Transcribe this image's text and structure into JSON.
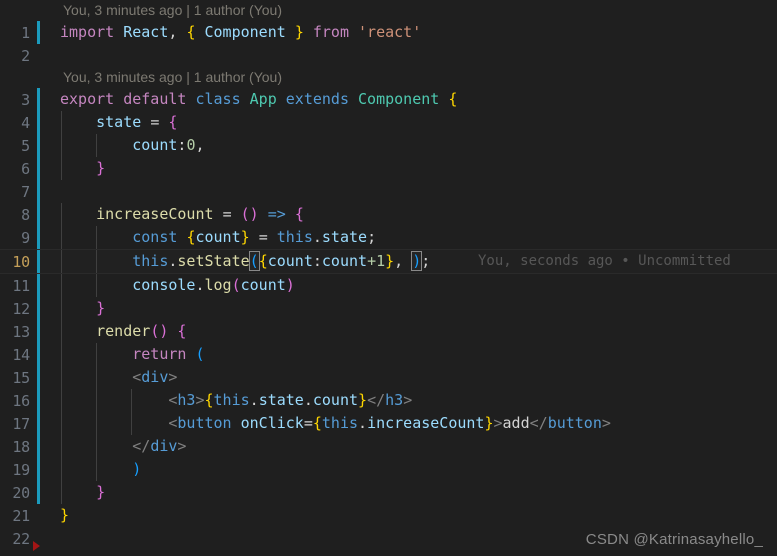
{
  "editor": {
    "language": "javascript-react",
    "theme": "dark-plus",
    "background_color": "#1f1f1f",
    "active_line": 10,
    "change_bar_color": "#1b9bbd",
    "active_line_number_color": "#c5a059"
  },
  "blame_annotations": [
    {
      "above_line": 1,
      "text": "You, 3 minutes ago | 1 author (You)"
    },
    {
      "above_line": 3,
      "text": "You, 3 minutes ago | 1 author (You)"
    }
  ],
  "inline_blame": {
    "line": 10,
    "text": "You, seconds ago • Uncommitted"
  },
  "line_numbers": [
    "1",
    "2",
    "3",
    "4",
    "5",
    "6",
    "7",
    "8",
    "9",
    "10",
    "11",
    "12",
    "13",
    "14",
    "15",
    "16",
    "17",
    "18",
    "19",
    "20",
    "21",
    "22"
  ],
  "code_lines": {
    "l1": "import React, { Component } from 'react'",
    "l2": "",
    "l3": "export default class App extends Component {",
    "l4": "    state = {",
    "l5": "        count:0,",
    "l6": "    }",
    "l7": "",
    "l8": "    increaseCount = () => {",
    "l9": "        const {count} = this.state;",
    "l10": "        this.setState({count:count+1}, );",
    "l11": "        console.log(count)",
    "l12": "    }",
    "l13": "    render() {",
    "l14": "        return (",
    "l15": "        <div>",
    "l16": "            <h3>{this.state.count}</h3>",
    "l17": "            <button onClick={this.increaseCount}>add</button>",
    "l18": "        </div>",
    "l19": "        )",
    "l20": "    }",
    "l21": "}",
    "l22": ""
  },
  "tokens": {
    "import": "import",
    "react_name": "React",
    "comma": ",",
    "brace_open": "{",
    "brace_close": "}",
    "component": "Component",
    "from": "from",
    "react_string": "'react'",
    "export": "export",
    "default": "default",
    "class": "class",
    "app": "App",
    "extends": "extends",
    "state": "state",
    "equals": "=",
    "count": "count",
    "colon": ":",
    "zero": "0",
    "increase_count": "increaseCount",
    "paren_open": "(",
    "paren_close": ")",
    "arrow": "=>",
    "const": "const",
    "this": "this",
    "dot": ".",
    "semicolon": ";",
    "set_state": "setState",
    "plus_one": "+1",
    "console": "console",
    "log": "log",
    "render": "render",
    "return": "return",
    "lt": "<",
    "gt": ">",
    "lt_slash": "</",
    "div": "div",
    "h3": "h3",
    "button": "button",
    "on_click": "onClick",
    "add": "add"
  },
  "markers": {
    "red_fold_triangle": "red-fold-triangle"
  },
  "watermark": {
    "text": "CSDN @Katrinasayhello_"
  }
}
